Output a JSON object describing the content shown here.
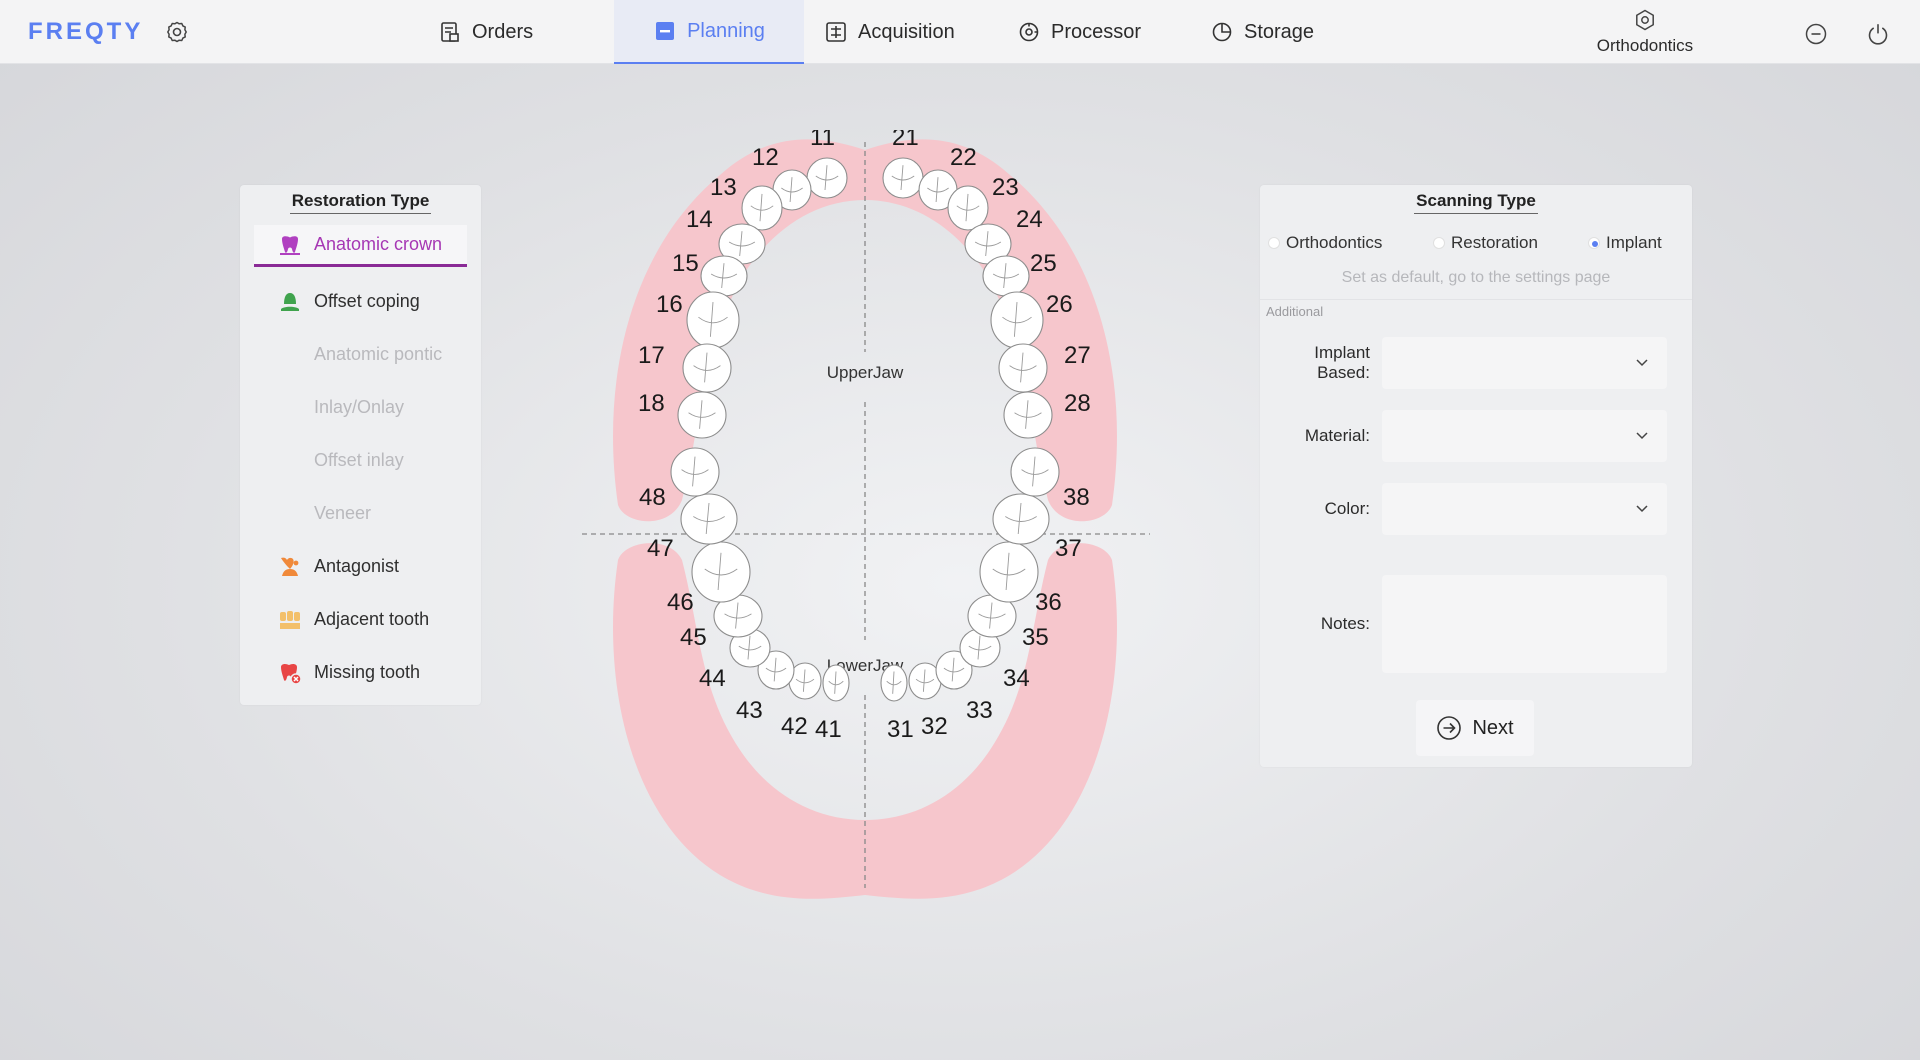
{
  "app": {
    "logo": "FREQTY",
    "mode_label": "Orthodontics"
  },
  "nav": {
    "tabs": [
      {
        "label": "Orders",
        "icon": "orders-icon",
        "active": false
      },
      {
        "label": "Planning",
        "icon": "planning-icon",
        "active": true
      },
      {
        "label": "Acquisition",
        "icon": "acquisition-icon",
        "active": false
      },
      {
        "label": "Processor",
        "icon": "processor-icon",
        "active": false
      },
      {
        "label": "Storage",
        "icon": "storage-icon",
        "active": false
      }
    ]
  },
  "colors": {
    "accent": "#5b7ff1",
    "active_type": "#a637b4",
    "gum": "#f6c6cc",
    "tooth": "#ffffff"
  },
  "restoration": {
    "title": "Restoration Type",
    "items": [
      {
        "label": "Anatomic crown",
        "icon": "anatomic-crown-icon",
        "state": "active"
      },
      {
        "label": "Offset coping",
        "icon": "offset-coping-icon",
        "state": "enabled"
      },
      {
        "label": "Anatomic pontic",
        "icon": "",
        "state": "disabled"
      },
      {
        "label": "Inlay/Onlay",
        "icon": "",
        "state": "disabled"
      },
      {
        "label": "Offset inlay",
        "icon": "",
        "state": "disabled"
      },
      {
        "label": "Veneer",
        "icon": "",
        "state": "disabled"
      },
      {
        "label": "Antagonist",
        "icon": "antagonist-icon",
        "state": "enabled"
      },
      {
        "label": "Adjacent tooth",
        "icon": "adjacent-tooth-icon",
        "state": "enabled"
      },
      {
        "label": "Missing tooth",
        "icon": "missing-tooth-icon",
        "state": "enabled"
      }
    ]
  },
  "chart": {
    "upper_label": "UpperJaw",
    "lower_label": "LowerJaw",
    "upper_right": [
      "11",
      "12",
      "13",
      "14",
      "15",
      "16",
      "17",
      "18"
    ],
    "upper_left": [
      "21",
      "22",
      "23",
      "24",
      "25",
      "26",
      "27",
      "28"
    ],
    "lower_left": [
      "31",
      "32",
      "33",
      "34",
      "35",
      "36",
      "37",
      "38"
    ],
    "lower_right": [
      "41",
      "42",
      "43",
      "44",
      "45",
      "46",
      "47",
      "48"
    ]
  },
  "scanning": {
    "title": "Scanning Type",
    "options": [
      {
        "label": "Orthodontics",
        "checked": false
      },
      {
        "label": "Restoration",
        "checked": false
      },
      {
        "label": "Implant",
        "checked": true
      }
    ],
    "hint": "Set as default, go to the settings page",
    "additional_label": "Additional",
    "fields": {
      "implant_based": {
        "label": "Implant Based:",
        "value": ""
      },
      "material": {
        "label": "Material:",
        "value": ""
      },
      "color": {
        "label": "Color:",
        "value": ""
      },
      "notes": {
        "label": "Notes:",
        "value": ""
      }
    },
    "next_label": "Next"
  }
}
